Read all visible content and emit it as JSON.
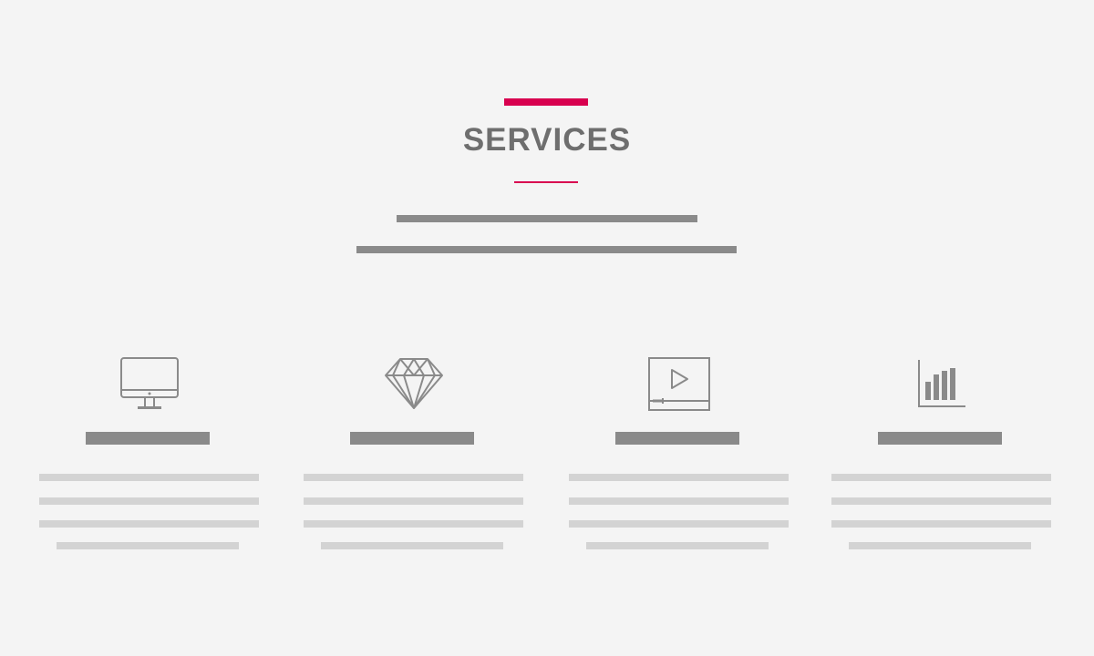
{
  "header": {
    "title": "SERVICES"
  },
  "colors": {
    "accent": "#d8004f",
    "heading": "#6e6e6e",
    "placeholder_dark": "#8a8a8a",
    "placeholder_light": "#d3d3d3",
    "background": "#f4f4f4"
  },
  "services": [
    {
      "icon": "monitor-icon"
    },
    {
      "icon": "diamond-icon"
    },
    {
      "icon": "video-player-icon"
    },
    {
      "icon": "bar-chart-icon"
    }
  ]
}
